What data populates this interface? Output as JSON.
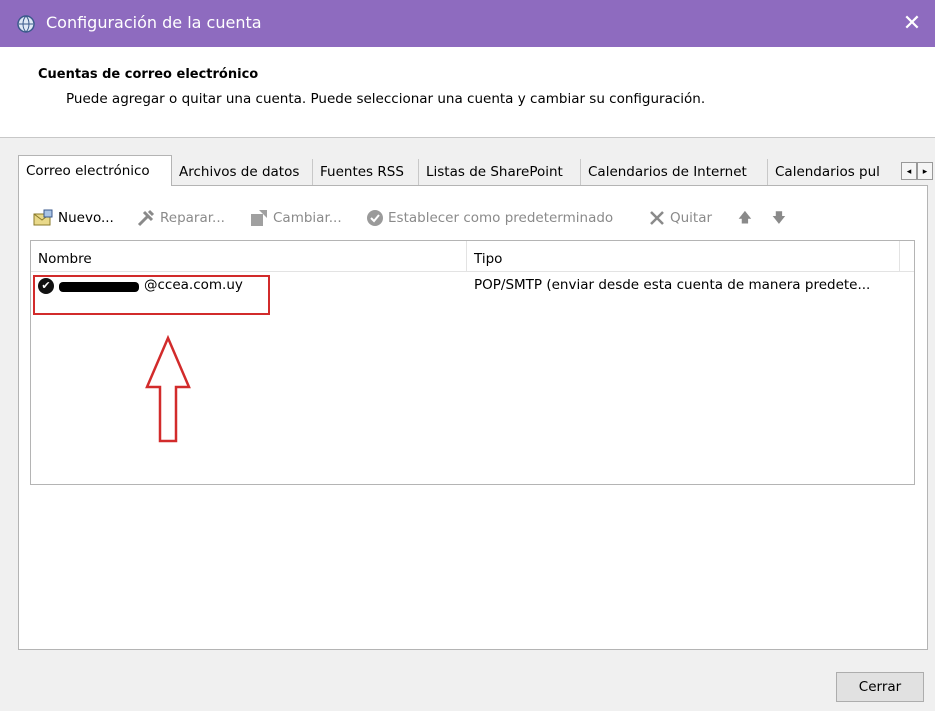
{
  "window": {
    "title": "Configuración de la cuenta",
    "close_glyph": "✕",
    "accent_color": "#8e6bbf"
  },
  "header": {
    "title": "Cuentas de correo electrónico",
    "subtitle": "Puede agregar o quitar una cuenta. Puede seleccionar una cuenta y cambiar su configuración."
  },
  "tabs": [
    {
      "label": "Correo electrónico",
      "active": true
    },
    {
      "label": "Archivos de datos"
    },
    {
      "label": "Fuentes RSS"
    },
    {
      "label": "Listas de SharePoint"
    },
    {
      "label": "Calendarios de Internet"
    },
    {
      "label": "Calendarios pul"
    }
  ],
  "tab_scroll": {
    "left": "◂",
    "right": "▸"
  },
  "toolbar": {
    "new": "Nuevo...",
    "repair": "Reparar...",
    "change": "Cambiar...",
    "set_default": "Establecer como predeterminado",
    "remove": "Quitar",
    "up_glyph": "🡅",
    "down_glyph": "🡇"
  },
  "list": {
    "columns": [
      "Nombre",
      "Tipo"
    ],
    "rows": [
      {
        "name": "@ccea.com.uy",
        "type": "POP/SMTP (enviar desde esta cuenta de manera predete...",
        "default": true
      }
    ]
  },
  "annotation": {
    "highlight_color": "#d22b2b"
  },
  "footer": {
    "close": "Cerrar"
  }
}
